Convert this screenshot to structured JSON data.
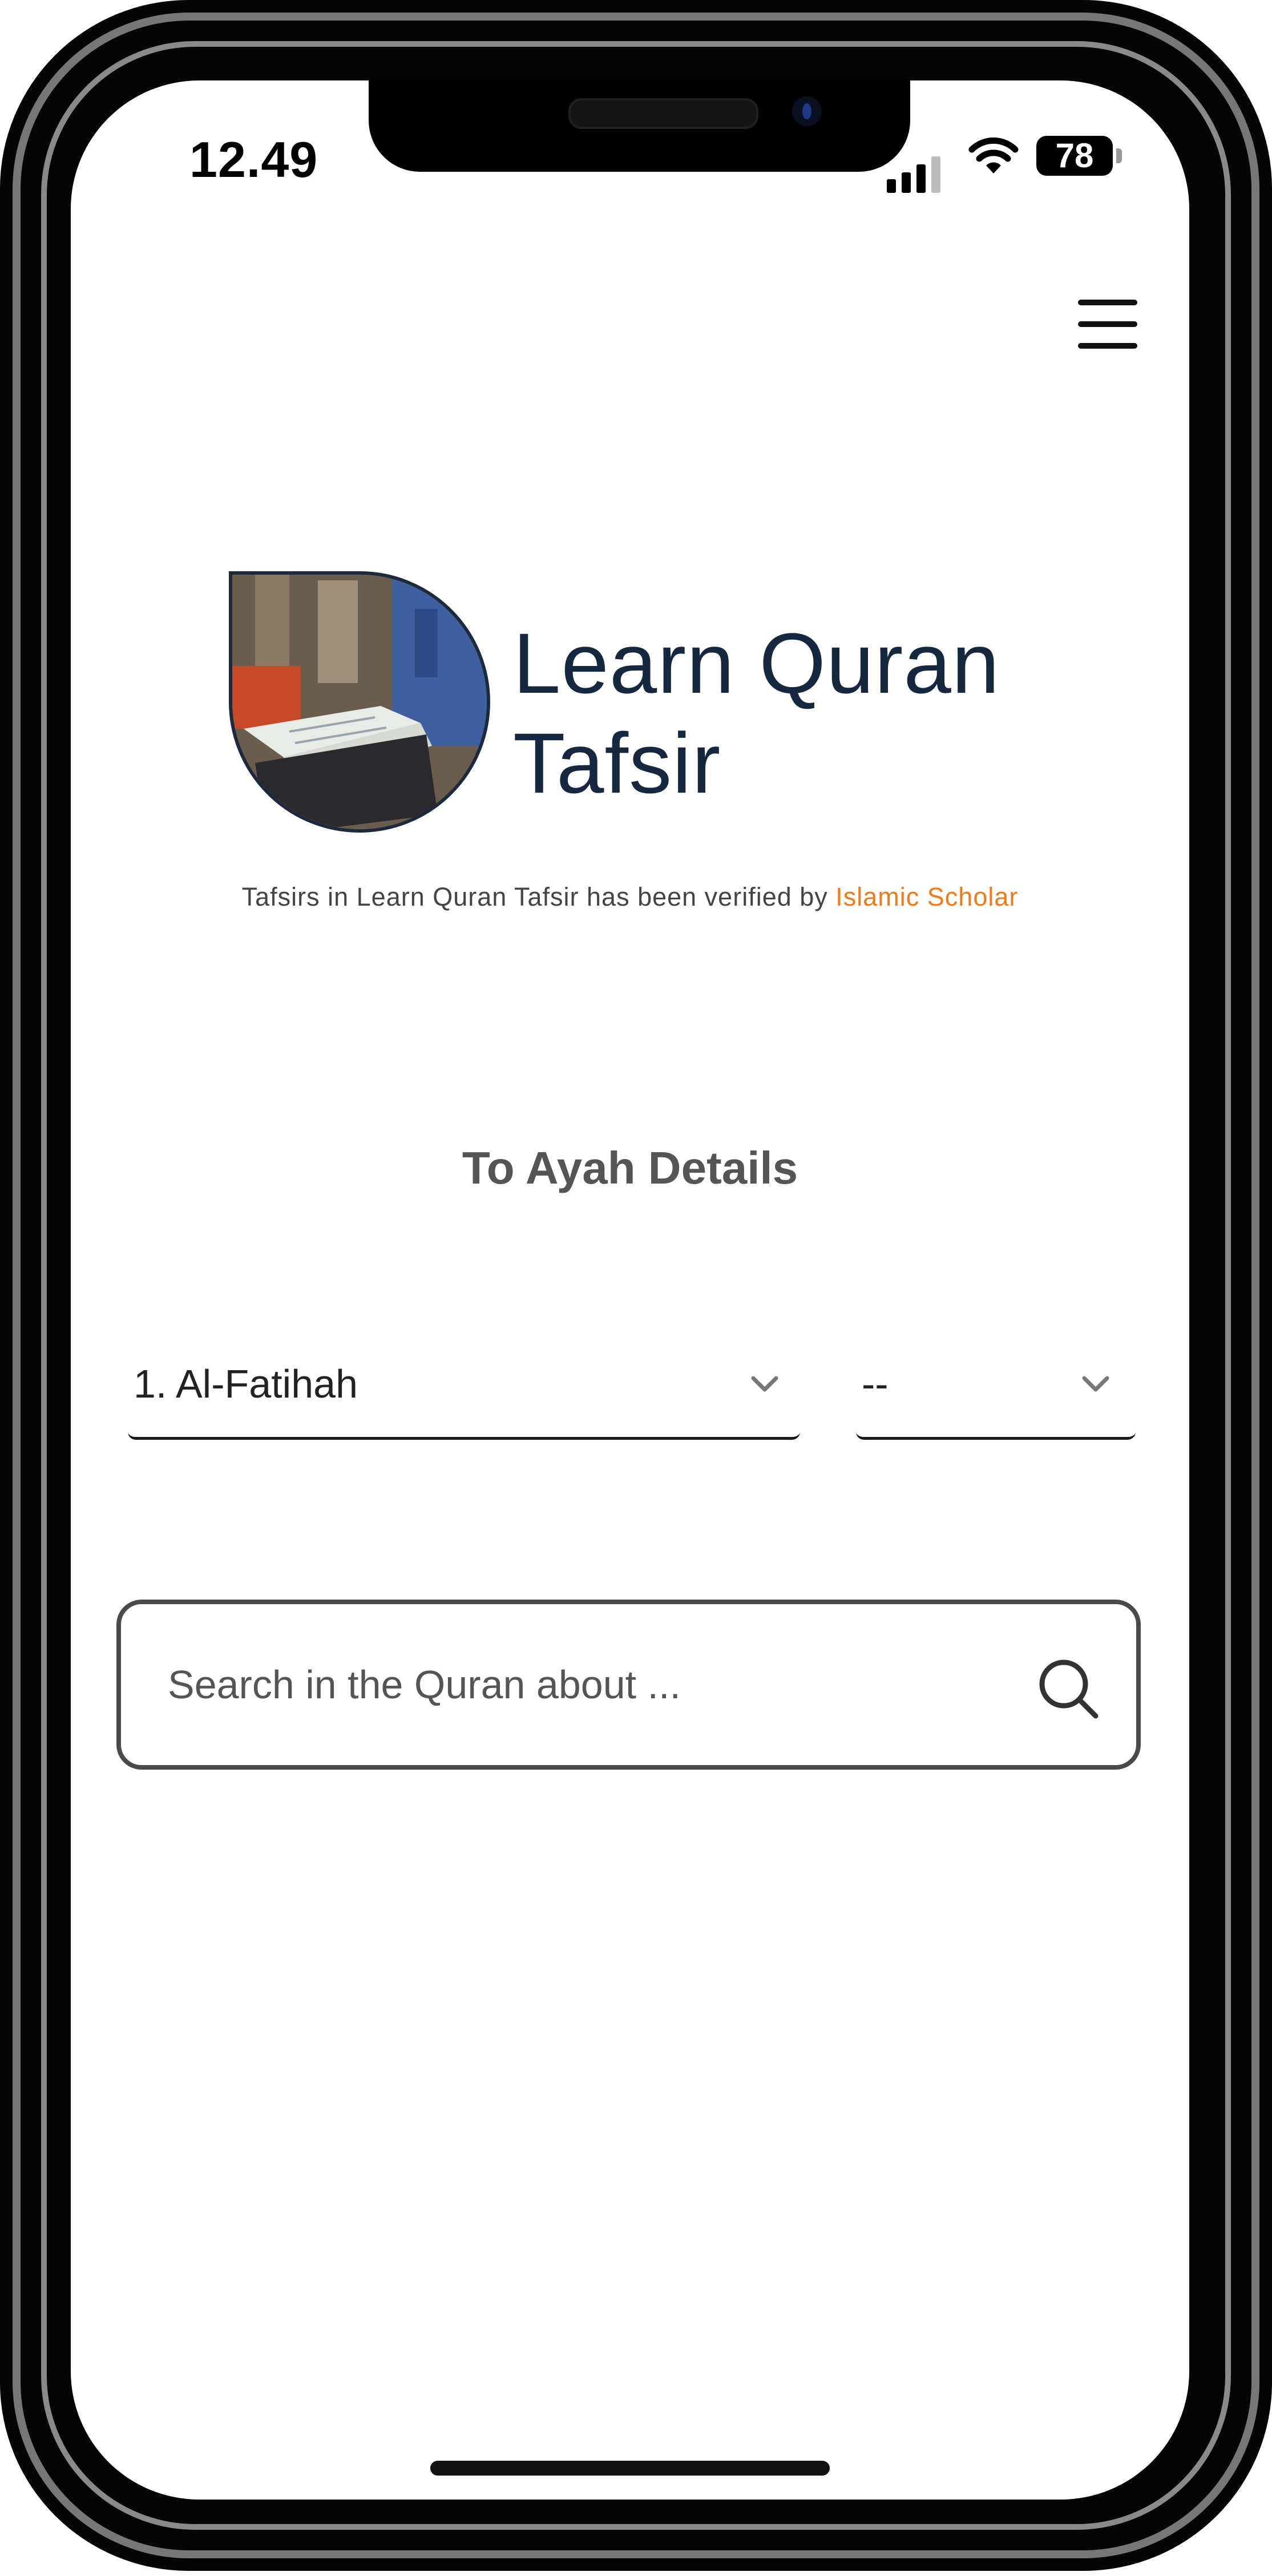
{
  "status_bar": {
    "time": "12.49",
    "battery": "78"
  },
  "header": {
    "menu_icon": "hamburger-menu-icon"
  },
  "logo": {
    "title": "Learn Quran",
    "subtitle": "Tafsir"
  },
  "verification": {
    "text": "Tafsirs in Learn Quran Tafsir has been verified by ",
    "link": "Islamic Scholar",
    "accent_color": "#f07a1a"
  },
  "ayah": {
    "heading": "To Ayah Details",
    "surah_select_value": "1. Al-Fatihah",
    "ayah_select_value": "--"
  },
  "search": {
    "placeholder": "Search in the Quran about ...",
    "icon": "search-icon"
  },
  "colors": {
    "brand_navy": "#16283f",
    "heading_gray": "#555555"
  }
}
